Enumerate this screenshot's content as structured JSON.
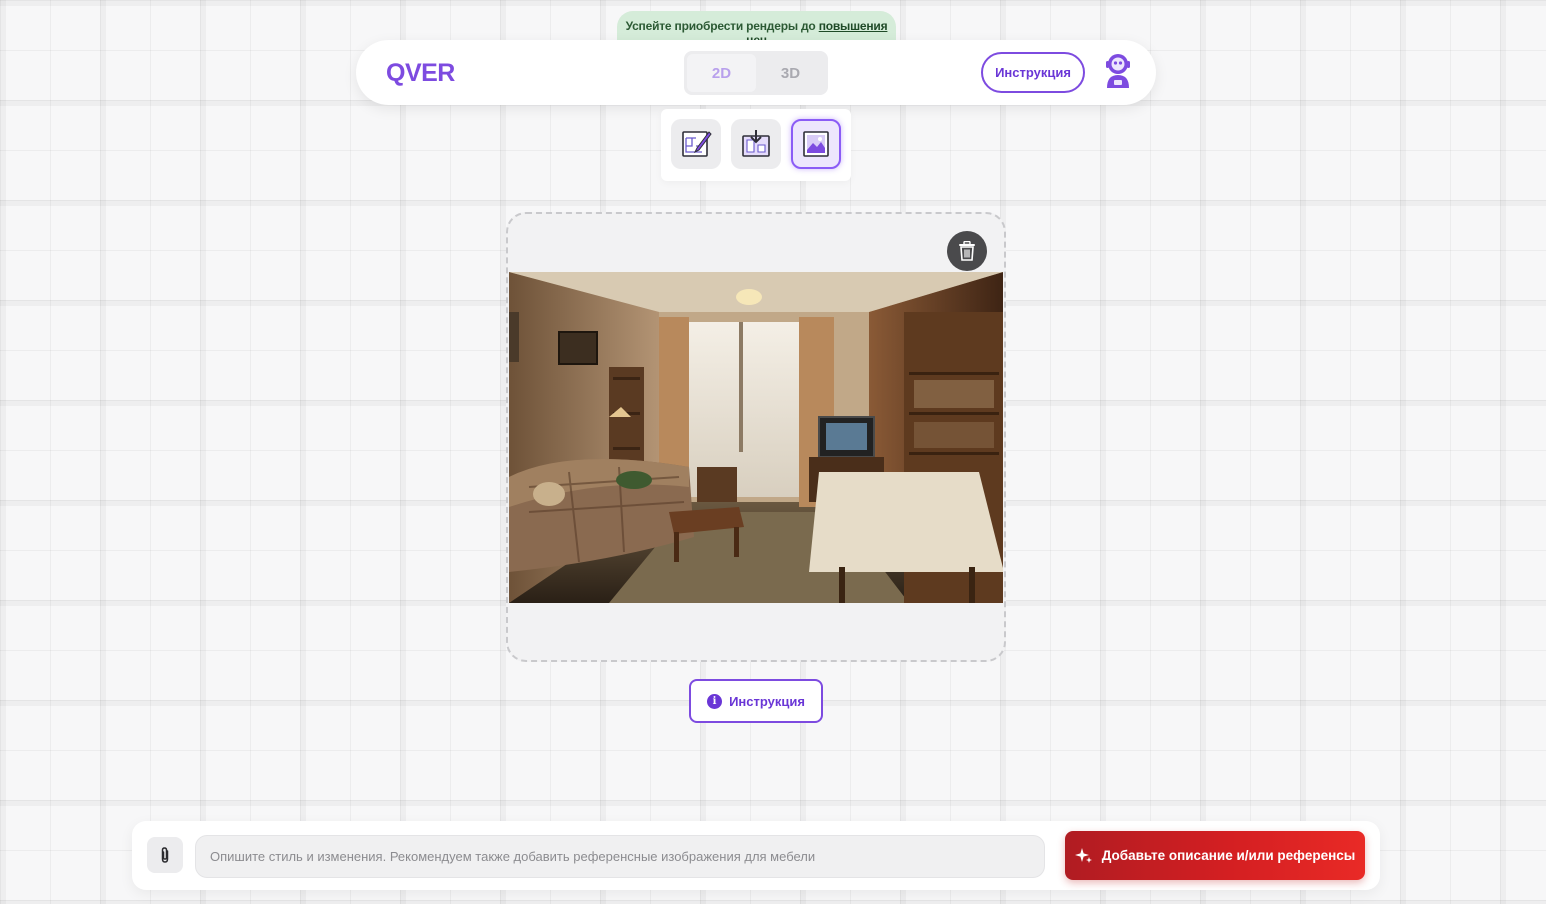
{
  "promo": {
    "text": "Успейте приобрести рендеры до",
    "link": "повышения цен"
  },
  "header": {
    "logo": "QVER",
    "modes": [
      {
        "label": "2D",
        "active": true
      },
      {
        "label": "3D",
        "active": false
      }
    ],
    "instruction_label": "Инструкция",
    "avatar_icon": "robot-avatar-icon"
  },
  "tools": [
    {
      "icon": "edit-plan-icon",
      "active": false
    },
    {
      "icon": "import-plan-icon",
      "active": false
    },
    {
      "icon": "photo-render-icon",
      "active": true
    }
  ],
  "upload": {
    "trash_icon": "trash-icon"
  },
  "instruction_button": {
    "label": "Инструкция",
    "icon": "info-icon"
  },
  "bottom_bar": {
    "attach_icon": "paperclip-icon",
    "prompt_placeholder": "Опишите стиль и изменения. Рекомендуем также добавить референсные изображения для мебели",
    "prompt_value": "",
    "submit_label": "Добавьте описание и/или референсы",
    "submit_icon": "sparkle-icon"
  },
  "colors": {
    "accent": "#7d4be0",
    "promo_bg": "#d5ecd9",
    "submit_red": "#d41f22"
  }
}
